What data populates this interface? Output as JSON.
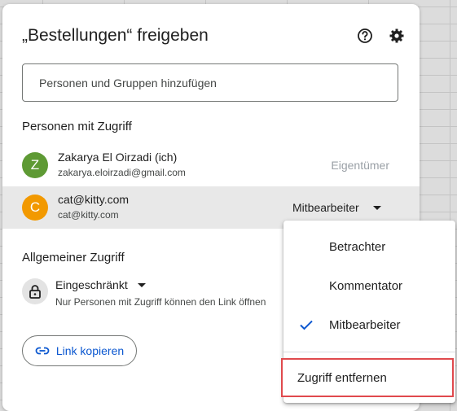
{
  "dialog": {
    "title": "„Bestellungen“ freigeben",
    "help_icon": "help-circle-icon",
    "settings_icon": "gear-icon",
    "add_people_placeholder": "Personen und Gruppen hinzufügen"
  },
  "people_section": {
    "heading": "Personen mit Zugriff",
    "people": [
      {
        "initial": "Z",
        "name": "Zakarya El Oirzadi (ich)",
        "email": "zakarya.eloirzadi@gmail.com",
        "role": "Eigentümer",
        "avatar_color": "#5e9a34"
      },
      {
        "initial": "C",
        "name": "cat@kitty.com",
        "email": "cat@kitty.com",
        "role": "Mitbearbeiter",
        "avatar_color": "#f29900"
      }
    ]
  },
  "general_access": {
    "heading": "Allgemeiner Zugriff",
    "level": "Eingeschränkt",
    "description": "Nur Personen mit Zugriff können den Link öffnen",
    "lock_icon": "lock-icon"
  },
  "copy_link": {
    "label": "Link kopieren",
    "icon": "link-icon"
  },
  "role_menu": {
    "items": [
      "Betrachter",
      "Kommentator",
      "Mitbearbeiter"
    ],
    "selected": "Mitbearbeiter",
    "remove_label": "Zugriff entfernen",
    "highlight_color": "#e0494d",
    "check_color": "#0b57d0"
  }
}
